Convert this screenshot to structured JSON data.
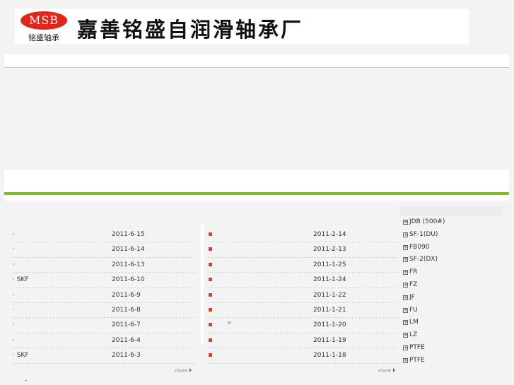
{
  "header": {
    "logo_text": "MSB",
    "logo_subtitle": "铭盛轴承",
    "company_name": "嘉善铭盛自润滑轴承厂"
  },
  "news_left": {
    "items": [
      {
        "title": "·",
        "date": "2011-6-15"
      },
      {
        "title": "·",
        "date": "2011-6-14"
      },
      {
        "title": "·",
        "date": "2011-6-13"
      },
      {
        "title": "· SKF",
        "date": "2011-6-10"
      },
      {
        "title": "·",
        "date": "2011-6-9"
      },
      {
        "title": "·",
        "date": "2011-6-8"
      },
      {
        "title": "·",
        "date": "2011-6-7"
      },
      {
        "title": "·",
        "date": "2011-6-4"
      },
      {
        "title": "·   SKF",
        "date": "2011-6-3"
      }
    ],
    "more_label": "more"
  },
  "news_right": {
    "items": [
      {
        "title": "",
        "date": "2011-2-14"
      },
      {
        "title": "",
        "date": "2011-2-13"
      },
      {
        "title": "",
        "date": "2011-1-25"
      },
      {
        "title": "",
        "date": "2011-1-24"
      },
      {
        "title": "",
        "date": "2011-1-22"
      },
      {
        "title": "",
        "date": "2011-1-21"
      },
      {
        "title": "\"",
        "date": "2011-1-20"
      },
      {
        "title": "",
        "date": "2011-1-19"
      },
      {
        "title": "",
        "date": "2011-1-18"
      }
    ],
    "more_label": "more"
  },
  "products": {
    "items": [
      "JDB (500#)",
      "SF-1(DU)",
      "FB090",
      "SF-2(DX)",
      "FR",
      "FZ",
      "JF",
      "FU",
      "LM",
      "LZ",
      "PTFE",
      "PTFE"
    ]
  },
  "footer": {
    "mark": "-"
  },
  "colors": {
    "accent_green": "#7bbd2d",
    "logo_red": "#e0251b",
    "bullet_red": "#e03a2a"
  }
}
